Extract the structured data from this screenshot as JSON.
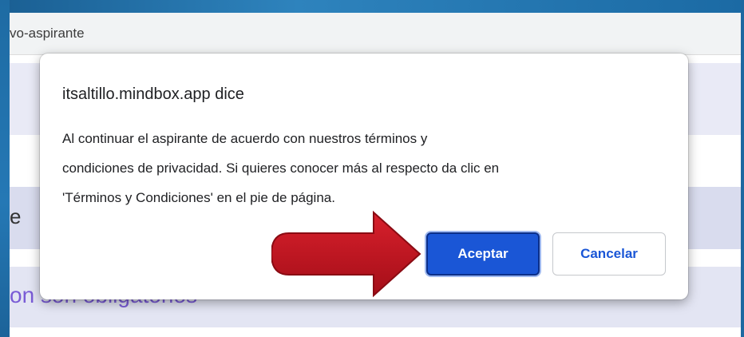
{
  "browser": {
    "address_text": "vo-aspirante"
  },
  "page": {
    "letter": "e",
    "heading": "on son obligatorios"
  },
  "dialog": {
    "title": "itsaltillo.mindbox.app dice",
    "message_lines": [
      "Al continuar el aspirante de acuerdo con nuestros términos y",
      "condiciones de privacidad. Si quieres conocer más al respecto da clic en",
      "'Términos y Condiciones' en el pie de página."
    ],
    "accept_label": "Aceptar",
    "cancel_label": "Cancelar"
  },
  "annotation": {
    "arrow_icon": "right-arrow-icon",
    "arrow_color": "#c0121e"
  },
  "colors": {
    "frame_blue": "#1f6fa8",
    "primary_button": "#1a56d6",
    "heading_purple": "#7a5cd6"
  }
}
